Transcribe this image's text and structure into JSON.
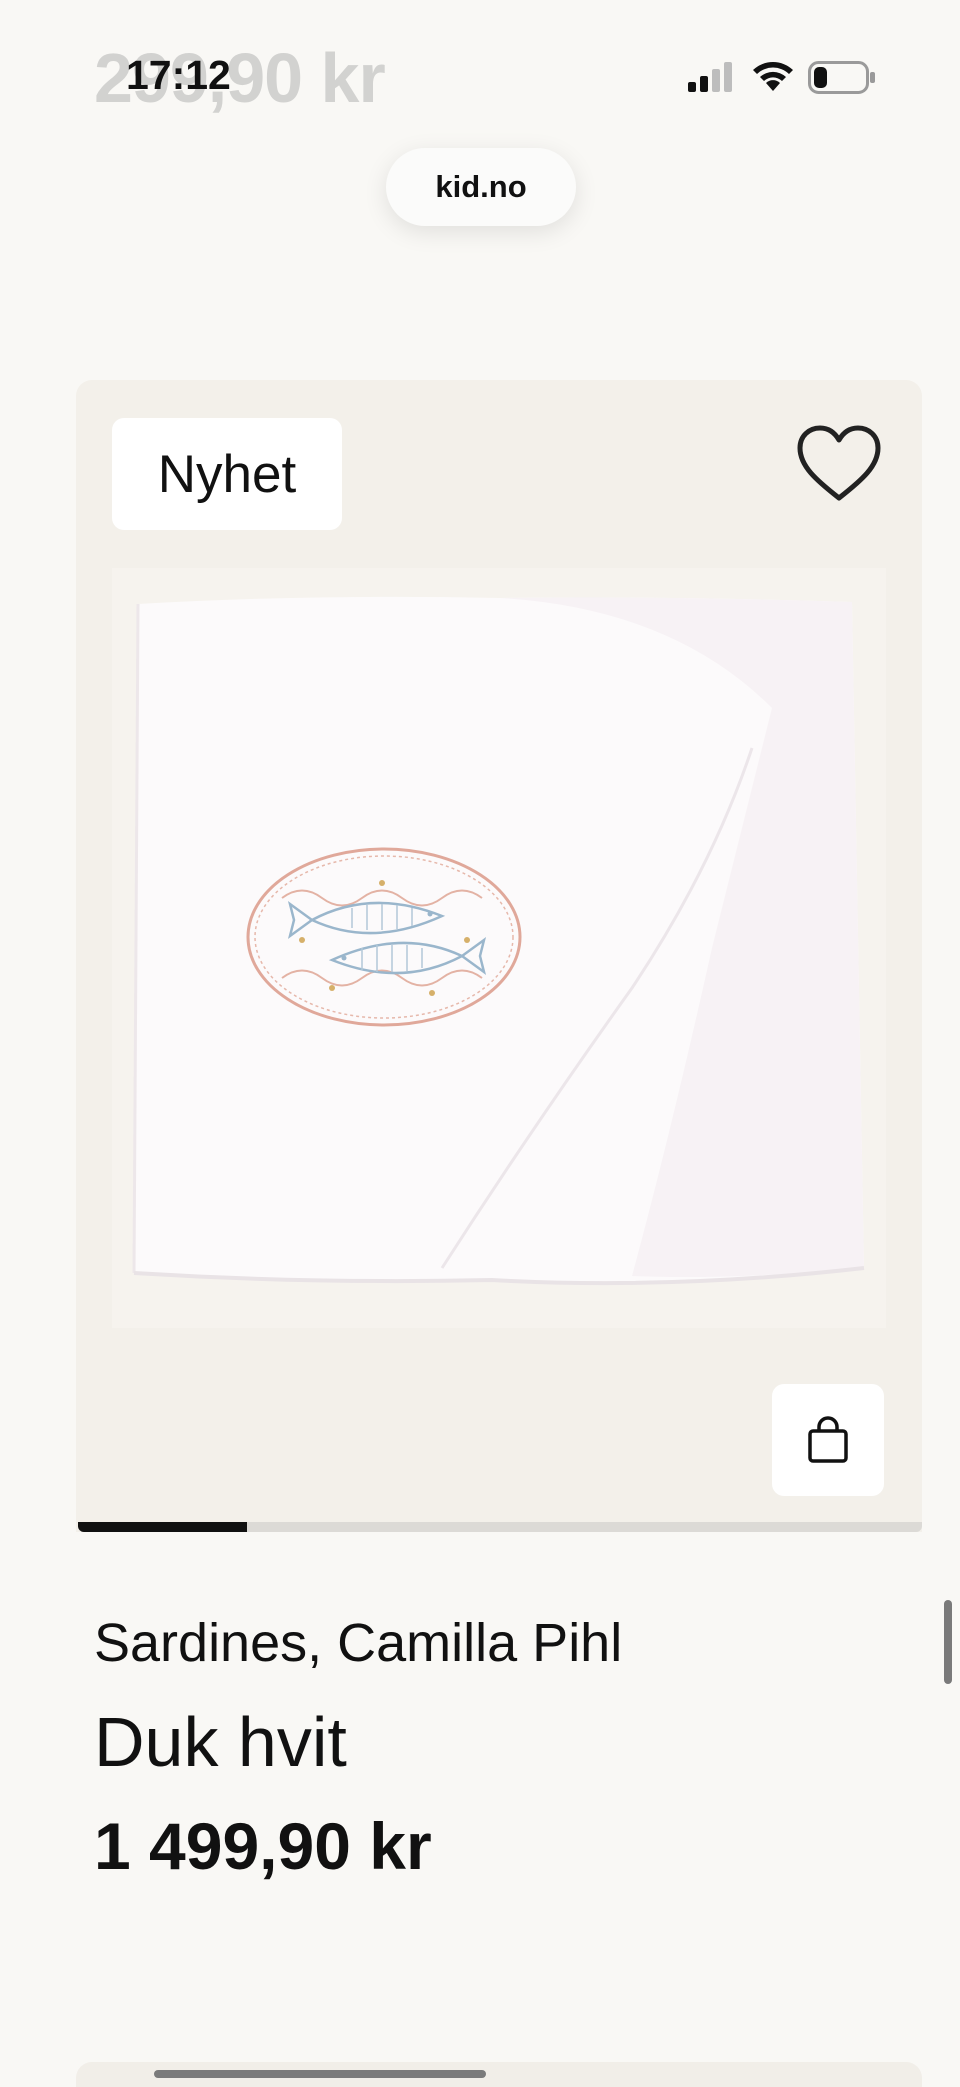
{
  "status_bar": {
    "time": "17:12",
    "ghost_price": "299,90 kr",
    "signal_icon": "cellular-signal-icon",
    "wifi_icon": "wifi-icon",
    "battery_icon": "battery-low-icon"
  },
  "browser": {
    "url": "kid.no"
  },
  "product": {
    "badge": "Nyhet",
    "favorite_icon": "heart-icon",
    "cart_icon": "shopping-bag-icon",
    "image_progress": 0.2,
    "brand": "Sardines, Camilla Pihl",
    "name": "Duk hvit",
    "price": "1 499,90 kr"
  },
  "colors": {
    "background": "#f9f8f5",
    "card_background": "#f3f0ea",
    "accent": "#111111"
  }
}
